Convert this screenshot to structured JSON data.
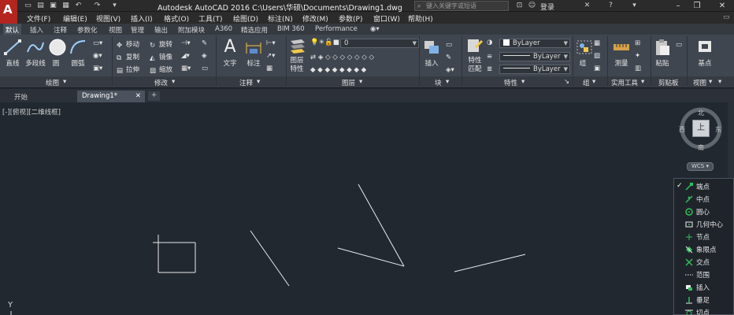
{
  "titlebar": {
    "title": "Autodesk AutoCAD 2016    C:\\Users\\华硕\\Documents\\Drawing1.dwg",
    "search_placeholder": "键入关键字或短语",
    "login": "登录"
  },
  "menu": [
    "文件(F)",
    "编辑(E)",
    "视图(V)",
    "插入(I)",
    "格式(O)",
    "工具(T)",
    "绘图(D)",
    "标注(N)",
    "修改(M)",
    "参数(P)",
    "窗口(W)",
    "帮助(H)"
  ],
  "ribbon_tabs": [
    "默认",
    "插入",
    "注释",
    "参数化",
    "视图",
    "管理",
    "输出",
    "附加模块",
    "A360",
    "精选应用",
    "BIM 360",
    "Performance"
  ],
  "ribbon": {
    "draw": {
      "line": "直线",
      "polyline": "多段线",
      "circle": "圆",
      "arc": "圆弧",
      "title": "绘图"
    },
    "modify": {
      "move": "移动",
      "rotate": "旋转",
      "copy": "复制",
      "mirror": "镜像",
      "stretch": "拉伸",
      "scale": "缩放",
      "title": "修改"
    },
    "annotation": {
      "text": "文字",
      "dimension": "标注",
      "title": "注释"
    },
    "layers": {
      "layer_props": "图层\n特性",
      "layer_combo": "0",
      "title": "图层"
    },
    "block": {
      "insert": "插入",
      "title": "块"
    },
    "properties": {
      "match": "特性\n匹配",
      "color": "ByLayer",
      "linetype": "ByLayer",
      "lineweight": "ByLayer",
      "title": "特性"
    },
    "groups": {
      "group": "组",
      "title": "组"
    },
    "utilities": {
      "measure": "测量",
      "title": "实用工具"
    },
    "clipboard": {
      "paste": "粘贴",
      "title": "剪贴板"
    },
    "view": {
      "base": "基点",
      "title": "视图"
    }
  },
  "doc_tabs": [
    "开始",
    "Drawing1*"
  ],
  "viewport_label": "[-][俯视][二维线框]",
  "viewcube": {
    "north": "北",
    "south": "南",
    "east": "东",
    "west": "西",
    "top": "上",
    "wcs": "WCS"
  },
  "ucs_y": "Y",
  "osnap_menu": [
    {
      "label": "端点",
      "checked": true
    },
    {
      "label": "中点",
      "checked": false
    },
    {
      "label": "圆心",
      "checked": false
    },
    {
      "label": "几何中心",
      "checked": false
    },
    {
      "label": "节点",
      "checked": false
    },
    {
      "label": "象限点",
      "checked": false
    },
    {
      "label": "交点",
      "checked": false
    },
    {
      "label": "范围",
      "checked": false
    },
    {
      "label": "插入",
      "checked": false
    },
    {
      "label": "垂足",
      "checked": false
    },
    {
      "label": "切点",
      "checked": false
    }
  ]
}
